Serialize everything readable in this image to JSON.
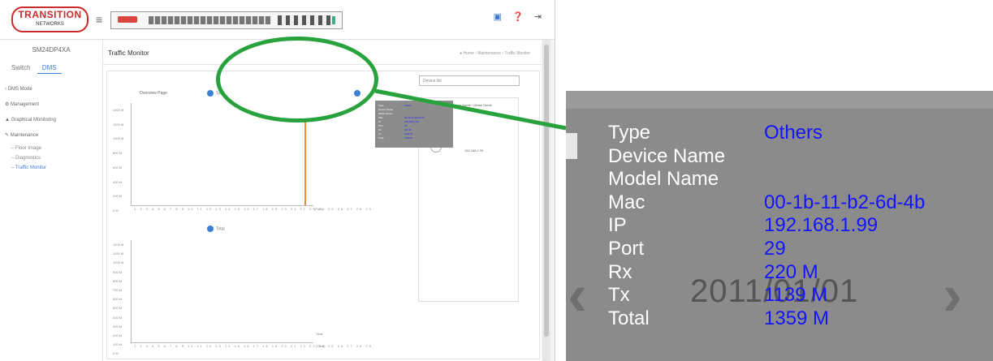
{
  "app": {
    "logo_text": "TRANSITION",
    "logo_sub": "NETWORKS",
    "model": "SM24DP4XA",
    "icons": {
      "menu": "hamburger-icon",
      "save": "save-icon",
      "help": "help-icon",
      "logout": "logout-icon"
    }
  },
  "sidebar": {
    "tabs": [
      "Switch",
      "DMS"
    ],
    "active_tab": "DMS",
    "items": [
      "‹ DMS Mode",
      "⚙ Management",
      "▲ Graphical Monitoring",
      "✎ Maintenance"
    ],
    "subitems": [
      "– Floor Image",
      "– Diagnostics",
      "– Traffic Monitor"
    ]
  },
  "page": {
    "title": "Traffic Monitor",
    "breadcrumb": "● Home › Maintenance › Traffic Monitor"
  },
  "chart_top": {
    "title": "Overview Page",
    "toggle_label": "Total",
    "yticks": [
      "1400 M",
      "1200 M",
      "1000 M",
      "800 M",
      "600 M",
      "400 M",
      "200 M",
      "0 M"
    ],
    "xticks": "1 2 3 4 5 6 7 8 9 10 11 12 13 14 15 16 17 18 19 20 21 22 23 24 25 26 27 28 29",
    "xlabel": "(Port)"
  },
  "chart_bottom": {
    "toggle_label": "Total",
    "yticks": [
      "1200 M",
      "1100 M",
      "1000 M",
      "900 M",
      "800 M",
      "700 M",
      "600 M",
      "500 M",
      "400 M",
      "300 M",
      "200 M",
      "100 M",
      "0 M"
    ],
    "xticks": "1 2 3 4 5 6 7 8 9 10 11 12 13 14 15 16 17 18 19 20 21 22 23 24 25 26 27 28 29",
    "xlabel": "(Time)",
    "legend": "Total"
  },
  "side_panel": {
    "search_placeholder": "Device list",
    "header": "Device Name / Model Name",
    "device_ip": "192.168.1.99"
  },
  "tooltip": {
    "rows": [
      {
        "label": "Type",
        "value": "Others"
      },
      {
        "label": "Device Name",
        "value": ""
      },
      {
        "label": "Model Name",
        "value": ""
      },
      {
        "label": "Mac",
        "value": "00-1b-11-b2-6d-4b"
      },
      {
        "label": "IP",
        "value": "192.168.1.99"
      },
      {
        "label": "Port",
        "value": "29"
      },
      {
        "label": "Rx",
        "value": "220 M"
      },
      {
        "label": "Tx",
        "value": "1139 M"
      },
      {
        "label": "Total",
        "value": "1359 M"
      }
    ],
    "background_date": "2011/01/01"
  },
  "colors": {
    "highlight_ellipse": "#28a23c",
    "tooltip_bg": "#8b8b8b",
    "tooltip_value": "#1414ff",
    "spike": "#f28c38",
    "accent": "#3b7fd4"
  }
}
